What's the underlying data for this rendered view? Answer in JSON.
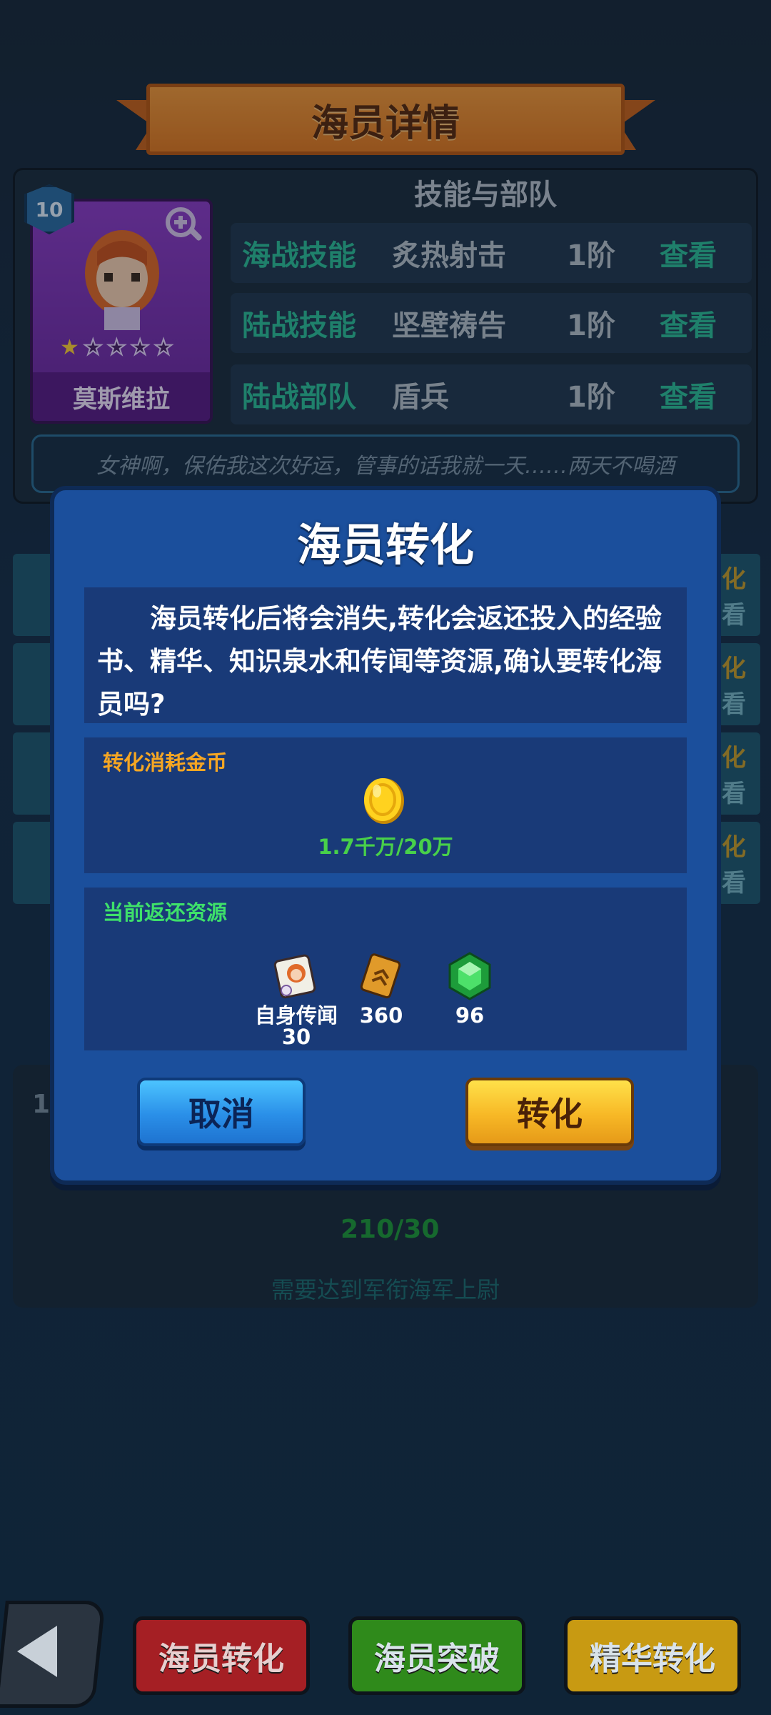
{
  "header": {
    "title": "海员详情"
  },
  "hero": {
    "level": "10",
    "name": "莫斯维拉",
    "stars_filled": 1,
    "stars_total": 5,
    "quote": "女神啊，保佑我这次好运，管事的话我就一天……两天不喝酒"
  },
  "skills": {
    "title": "技能与部队",
    "rows": [
      {
        "category": "海战技能",
        "name": "炙热射击",
        "level": "1阶",
        "action": "查看"
      },
      {
        "category": "陆战技能",
        "name": "坚壁祷告",
        "level": "1阶",
        "action": "查看"
      },
      {
        "category": "陆战部队",
        "name": "盾兵",
        "level": "1阶",
        "action": "查看"
      }
    ]
  },
  "background_list": {
    "right_labels": [
      {
        "top": "化",
        "bottom": "看"
      },
      {
        "top": "化",
        "bottom": "看"
      },
      {
        "top": "化",
        "bottom": "看"
      },
      {
        "top": "化",
        "bottom": "看"
      }
    ],
    "left_number": "1",
    "requirement_count": "210/30",
    "requirement_hint": "需要达到军衔海军上尉"
  },
  "dialog": {
    "title": "海员转化",
    "message": "海员转化后将会消失,转化会返还投入的经验书、精华、知识泉水和传闻等资源,确认要转化海员吗?",
    "cost": {
      "label": "转化消耗金币",
      "amount": "1.7千万/20万",
      "icon": "gold-coin-icon"
    },
    "returns": {
      "label": "当前返还资源",
      "items": [
        {
          "name": "自身传闻",
          "value": "30",
          "icon": "rumor-scroll-icon"
        },
        {
          "name": "",
          "value": "360",
          "icon": "exp-book-icon"
        },
        {
          "name": "",
          "value": "96",
          "icon": "green-gem-icon"
        }
      ]
    },
    "cancel_label": "取消",
    "confirm_label": "转化"
  },
  "bottom_bar": {
    "back_icon": "back-arrow-icon",
    "buttons": [
      {
        "label": "海员转化",
        "color": "#a51f24"
      },
      {
        "label": "海员突破",
        "color": "#2f8a1b"
      },
      {
        "label": "精华转化",
        "color": "#c89a12"
      }
    ]
  },
  "colors": {
    "cost_label": "#f5a623",
    "return_label": "#3ee06a",
    "amount": "#48d04a"
  }
}
